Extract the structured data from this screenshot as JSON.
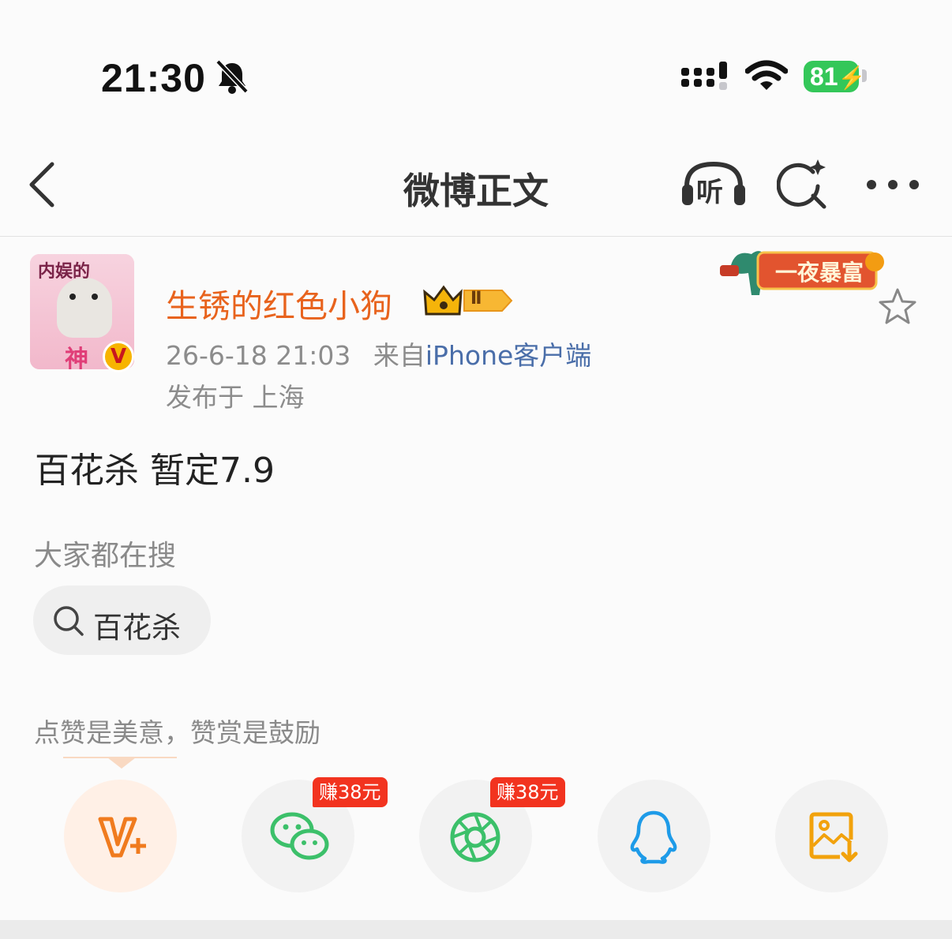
{
  "status_bar": {
    "time": "21:30",
    "battery": "81",
    "icons": [
      "bell-slash-icon",
      "signal-icon",
      "wifi-icon",
      "battery-charging-icon"
    ]
  },
  "nav": {
    "title": "微博正文",
    "listen_label": "听",
    "icons": [
      "back-chevron-icon",
      "listen-headphones-icon",
      "ai-search-icon",
      "more-dots-icon"
    ]
  },
  "author": {
    "name": "生锈的红色小狗",
    "avatar_text_top": "内娱的",
    "avatar_text_bottom": "神",
    "verified_badge": "V",
    "level_badge": "Ⅱ",
    "date": "26-6-18 21:03",
    "source_prefix": "来自",
    "source": "iPhone客户端",
    "location": "发布于 上海",
    "banner_text": "一夜暴富"
  },
  "post": {
    "text": "百花杀 暂定7.9"
  },
  "search_section": {
    "label": "大家都在搜",
    "chip": "百花杀"
  },
  "reward": {
    "tip": "点赞是美意，赞赏是鼓励"
  },
  "share": {
    "items": [
      {
        "name": "vplus",
        "icon": "vplus-reward-icon",
        "badge": ""
      },
      {
        "name": "wechat",
        "icon": "wechat-icon",
        "badge": "赚38元"
      },
      {
        "name": "moments",
        "icon": "wechat-moments-icon",
        "badge": "赚38元"
      },
      {
        "name": "qq",
        "icon": "qq-icon",
        "badge": ""
      },
      {
        "name": "save-image",
        "icon": "save-image-icon",
        "badge": ""
      }
    ]
  },
  "colors": {
    "username": "#e8631d",
    "source_link": "#4a6ea9",
    "battery": "#34c759",
    "earn_badge": "#f2331f",
    "wechat": "#3cc06a",
    "qq": "#1e9be8",
    "save": "#f2a20c"
  }
}
